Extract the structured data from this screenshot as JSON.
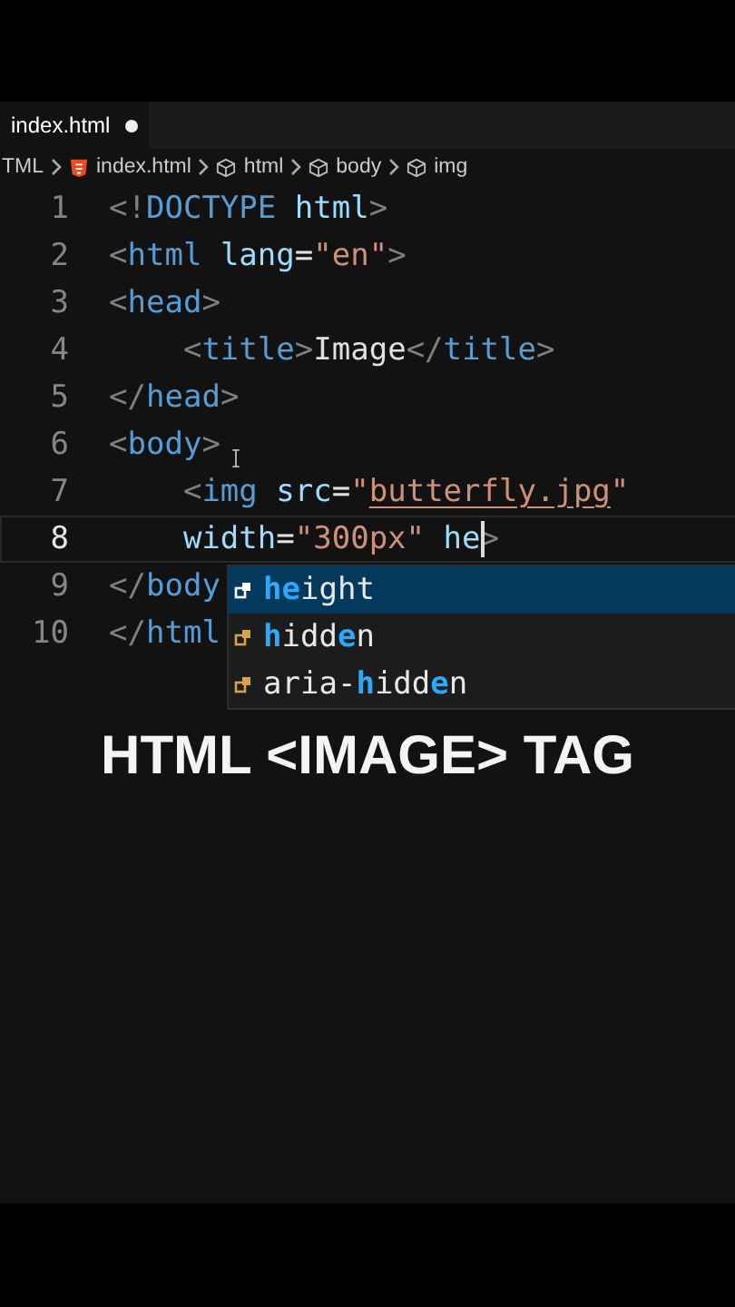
{
  "tabs": [
    {
      "label": "index.html",
      "selected": true,
      "modified": true
    }
  ],
  "breadcrumbs": [
    {
      "label": "TML",
      "kind": "folder"
    },
    {
      "label": "index.html",
      "kind": "file"
    },
    {
      "label": "html",
      "kind": "element"
    },
    {
      "label": "body",
      "kind": "element"
    },
    {
      "label": "img",
      "kind": "element"
    }
  ],
  "code_lines": [
    {
      "number": "1",
      "current": false,
      "tokens": [
        {
          "text": "<!",
          "kind": "punct"
        },
        {
          "text": "DOCTYPE",
          "kind": "tag"
        },
        {
          "text": " html",
          "kind": "attr"
        },
        {
          "text": ">",
          "kind": "punct"
        }
      ]
    },
    {
      "number": "2",
      "current": false,
      "tokens": [
        {
          "text": "<",
          "kind": "punct"
        },
        {
          "text": "html",
          "kind": "tag"
        },
        {
          "text": " lang",
          "kind": "attr"
        },
        {
          "text": "=",
          "kind": "text"
        },
        {
          "text": "\"en\"",
          "kind": "string"
        },
        {
          "text": ">",
          "kind": "punct"
        }
      ]
    },
    {
      "number": "3",
      "current": false,
      "tokens": [
        {
          "text": "<",
          "kind": "punct"
        },
        {
          "text": "head",
          "kind": "tag"
        },
        {
          "text": ">",
          "kind": "punct"
        }
      ]
    },
    {
      "number": "4",
      "current": false,
      "tokens": [
        {
          "text": "    <",
          "kind": "punct"
        },
        {
          "text": "title",
          "kind": "tag"
        },
        {
          "text": ">",
          "kind": "punct"
        },
        {
          "text": "Image",
          "kind": "text"
        },
        {
          "text": "</",
          "kind": "punct"
        },
        {
          "text": "title",
          "kind": "tag"
        },
        {
          "text": ">",
          "kind": "punct"
        }
      ]
    },
    {
      "number": "5",
      "current": false,
      "tokens": [
        {
          "text": "</",
          "kind": "punct"
        },
        {
          "text": "head",
          "kind": "tag"
        },
        {
          "text": ">",
          "kind": "punct"
        }
      ]
    },
    {
      "number": "6",
      "current": false,
      "tokens": [
        {
          "text": "<",
          "kind": "punct"
        },
        {
          "text": "body",
          "kind": "tag"
        },
        {
          "text": ">",
          "kind": "punct"
        }
      ]
    },
    {
      "number": "7",
      "current": false,
      "tokens": [
        {
          "text": "    <",
          "kind": "punct"
        },
        {
          "text": "img",
          "kind": "tag"
        },
        {
          "text": " src",
          "kind": "attr"
        },
        {
          "text": "=",
          "kind": "text"
        },
        {
          "text": "\"",
          "kind": "string"
        },
        {
          "text": "butterfly.jpg",
          "kind": "link"
        },
        {
          "text": "\"",
          "kind": "string"
        }
      ]
    },
    {
      "number": "8",
      "current": true,
      "tokens": [
        {
          "text": "    width",
          "kind": "attr"
        },
        {
          "text": "=",
          "kind": "text"
        },
        {
          "text": "\"300px\"",
          "kind": "string"
        },
        {
          "text": " he",
          "kind": "attr"
        },
        {
          "text": ">",
          "kind": "punct"
        }
      ]
    },
    {
      "number": "9",
      "current": false,
      "tokens": [
        {
          "text": "</",
          "kind": "punct"
        },
        {
          "text": "body",
          "kind": "tag"
        }
      ]
    },
    {
      "number": "10",
      "current": false,
      "tokens": [
        {
          "text": "</",
          "kind": "punct"
        },
        {
          "text": "html",
          "kind": "tag"
        }
      ]
    }
  ],
  "suggestions": [
    {
      "selected": true,
      "parts": [
        {
          "text": "he",
          "match": true
        },
        {
          "text": "ight",
          "match": false
        }
      ]
    },
    {
      "selected": false,
      "parts": [
        {
          "text": "h",
          "match": true
        },
        {
          "text": "idd",
          "match": false
        },
        {
          "text": "e",
          "match": true
        },
        {
          "text": "n",
          "match": false
        }
      ]
    },
    {
      "selected": false,
      "parts": [
        {
          "text": "aria-",
          "match": false
        },
        {
          "text": "h",
          "match": true
        },
        {
          "text": "idd",
          "match": false
        },
        {
          "text": "e",
          "match": true
        },
        {
          "text": "n",
          "match": false
        }
      ]
    }
  ],
  "caption": "HTML <IMAGE> TAG"
}
